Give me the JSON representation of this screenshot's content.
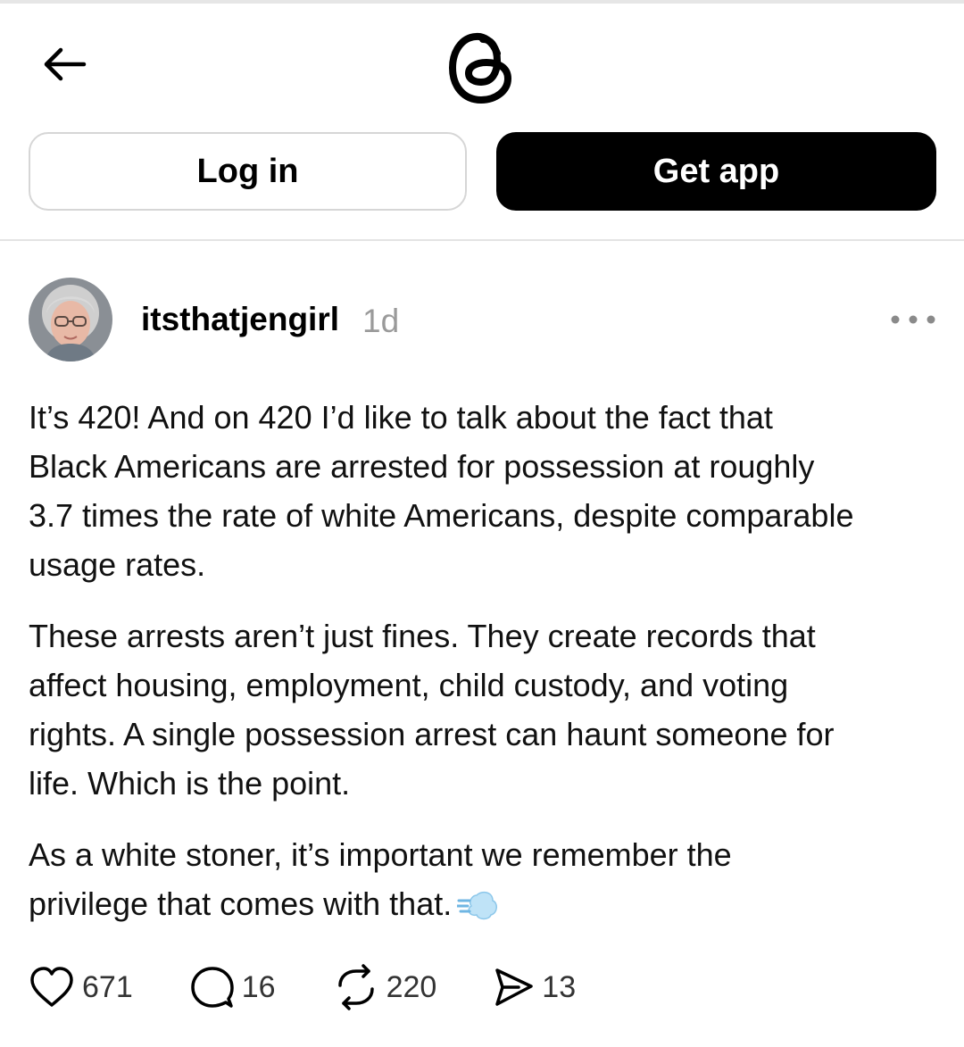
{
  "header": {
    "back_icon": "arrow-left-icon",
    "logo_icon": "threads-logo"
  },
  "auth": {
    "login_label": "Log in",
    "get_app_label": "Get app"
  },
  "post": {
    "author": {
      "username": "itsthatjengirl",
      "avatar_icon": "user-avatar"
    },
    "timestamp": "1d",
    "more_icon": "more-horizontal-icon",
    "paragraphs": [
      {
        "lines": [
          "It’s 420! And on 420 I’d like to talk about the fact that",
          "Black Americans are arrested for possession at roughly",
          "3.7 times the rate of white Americans, despite comparable",
          "usage rates."
        ]
      },
      {
        "lines": [
          "These arrests aren’t just fines. They create records that",
          "affect housing, employment, child custody, and voting",
          "rights. A single possession arrest can haunt someone for",
          "life. Which is the point."
        ]
      },
      {
        "lines": [
          "As a white stoner, it’s important we remember the",
          "privilege that comes with that."
        ],
        "trailing_emoji": "dashing-away-emoji"
      }
    ],
    "actions": {
      "likes": "671",
      "replies": "16",
      "reposts": "220",
      "shares": "13"
    }
  },
  "colors": {
    "primary_button_bg": "#000000",
    "secondary_button_border": "#d6d6d6",
    "muted_text": "#9a9a9a",
    "divider": "#e4e4e4"
  }
}
